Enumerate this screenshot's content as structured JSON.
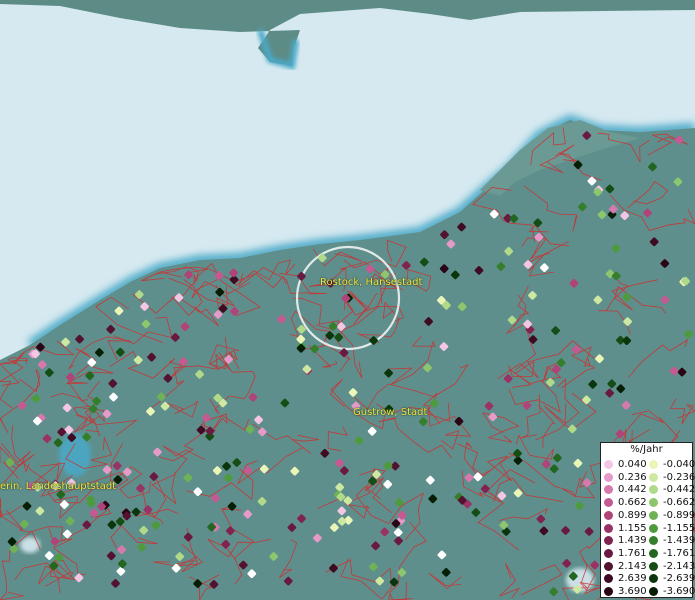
{
  "map": {
    "places": [
      {
        "name": "Rostock, Hansestadt"
      },
      {
        "name": "Güstrow, Stadt"
      },
      {
        "name": "erin, Landeshauptstadt"
      }
    ],
    "colors": {
      "sea": "#d6e9f0",
      "coast": "#4aa9c8",
      "land": "#5f8f8c",
      "boundary": "#d22b2b",
      "marker_outline": "#ffffff"
    }
  },
  "legend": {
    "title": "%/Jahr",
    "positive": [
      {
        "label": "0.040",
        "color": "#f4c6e4"
      },
      {
        "label": "0.236",
        "color": "#e69ac8"
      },
      {
        "label": "0.442",
        "color": "#d879ae"
      },
      {
        "label": "0.662",
        "color": "#c45a91"
      },
      {
        "label": "0.899",
        "color": "#b04478"
      },
      {
        "label": "1.155",
        "color": "#993366"
      },
      {
        "label": "1.439",
        "color": "#80244f"
      },
      {
        "label": "1.761",
        "color": "#691a40"
      },
      {
        "label": "2.143",
        "color": "#531230"
      },
      {
        "label": "2.639",
        "color": "#3e0b22"
      },
      {
        "label": "3.690",
        "color": "#2a0515"
      }
    ],
    "negative": [
      {
        "label": "-0.040",
        "color": "#eaf5b8"
      },
      {
        "label": "-0.236",
        "color": "#cde8a0"
      },
      {
        "label": "-0.442",
        "color": "#b0d98a"
      },
      {
        "label": "-0.662",
        "color": "#8dc66e"
      },
      {
        "label": "-0.899",
        "color": "#6fb255"
      },
      {
        "label": "-1.155",
        "color": "#4e9b3e"
      },
      {
        "label": "-1.439",
        "color": "#357f2c"
      },
      {
        "label": "-1.761",
        "color": "#22661f"
      },
      {
        "label": "-2.143",
        "color": "#154d14"
      },
      {
        "label": "-2.639",
        "color": "#0b360b"
      },
      {
        "label": "-3.690",
        "color": "#041f05"
      }
    ]
  }
}
